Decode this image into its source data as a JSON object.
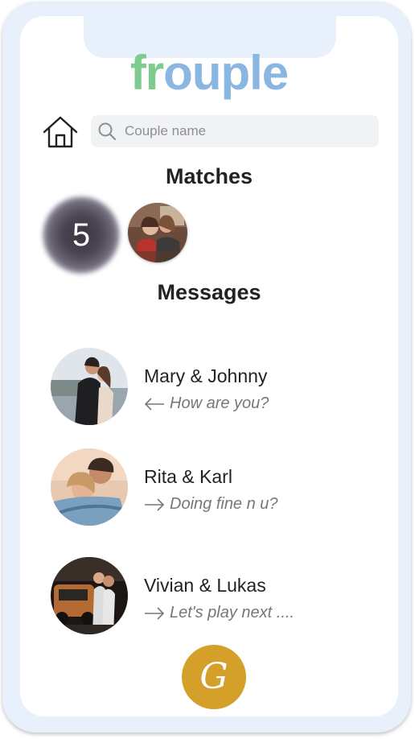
{
  "app": {
    "logo_part1": "fr",
    "logo_part2": "ouple"
  },
  "search": {
    "placeholder": "Couple name",
    "value": ""
  },
  "matches": {
    "title": "Matches",
    "count": "5"
  },
  "messages": {
    "title": "Messages",
    "items": [
      {
        "name": "Mary & Johnny",
        "direction": "incoming",
        "arrow_icon": "arrow-left-icon",
        "preview": "How are you?"
      },
      {
        "name": "Rita & Karl",
        "direction": "outgoing",
        "arrow_icon": "arrow-right-icon",
        "preview": "Doing fine n u?"
      },
      {
        "name": "Vivian & Lukas",
        "direction": "outgoing",
        "arrow_icon": "arrow-right-icon",
        "preview": "Let's play next ...."
      }
    ]
  },
  "fab": {
    "label": "G"
  },
  "colors": {
    "frame": "#e7f0fb",
    "logo_green": "#7ecb8f",
    "logo_blue": "#8ab6e2",
    "fab": "#d4a02a",
    "search_bg": "#f1f2f4"
  }
}
